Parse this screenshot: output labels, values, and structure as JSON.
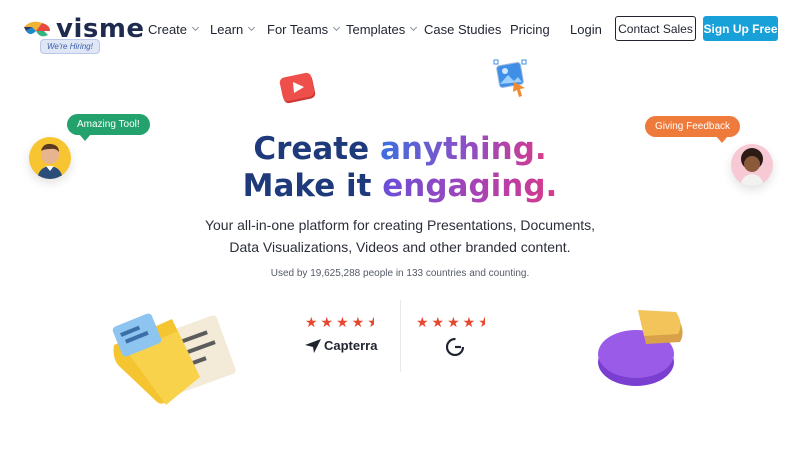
{
  "brand": {
    "logo_text": "visme",
    "hiring_badge": "We're Hiring!"
  },
  "nav": {
    "create": "Create",
    "learn": "Learn",
    "for_teams": "For Teams",
    "templates": "Templates",
    "case_studies": "Case Studies",
    "pricing": "Pricing",
    "login": "Login"
  },
  "buttons": {
    "contact_sales": "Contact Sales",
    "sign_up": "Sign Up Free"
  },
  "hero": {
    "line1_a": "Create ",
    "line1_b": "anything.",
    "line2_a": "Make it ",
    "line2_b": "engaging.",
    "subtitle_line1": "Your all-in-one platform for creating Presentations, Documents,",
    "subtitle_line2": "Data Visualizations, Videos and other branded content.",
    "used_by": "Used by 19,625,288 people in 133 countries and counting."
  },
  "testimonials": {
    "left_bubble": "Amazing Tool!",
    "right_bubble": "Giving Feedback"
  },
  "ratings": {
    "capterra": {
      "stars": 4.5,
      "name": "Capterra"
    },
    "g2": {
      "stars": 4.5,
      "name": "G2"
    }
  },
  "colors": {
    "accent": "#18a0d8",
    "title_dark": "#1e3a7a",
    "star": "#e8472f",
    "bubble_green": "#23a26d",
    "bubble_orange": "#ee7a3c"
  }
}
